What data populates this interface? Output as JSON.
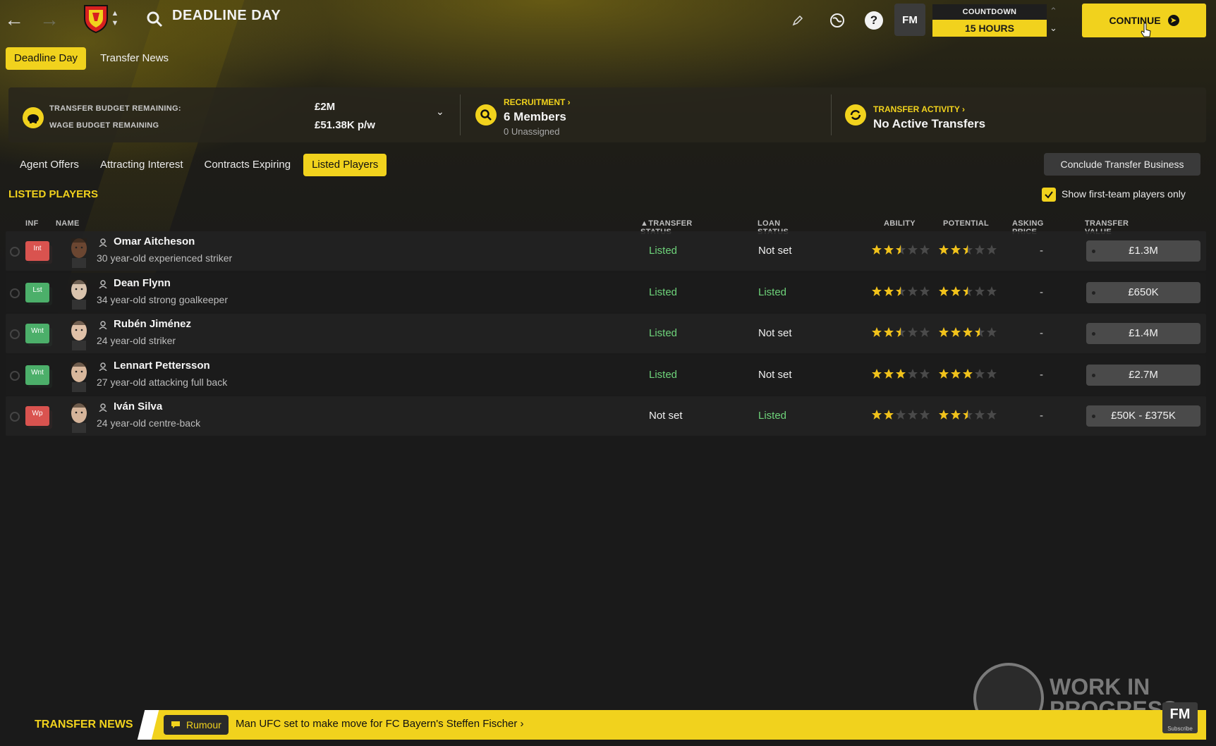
{
  "header": {
    "title": "DEADLINE DAY",
    "countdown_label": "COUNTDOWN",
    "countdown_value": "15 HOURS",
    "continue_label": "CONTINUE",
    "fm_label": "FM",
    "help_label": "?"
  },
  "top_tabs": [
    {
      "label": "Deadline Day",
      "active": true
    },
    {
      "label": "Transfer News",
      "active": false
    }
  ],
  "budget": {
    "transfer_label": "TRANSFER BUDGET REMAINING:",
    "wage_label": "WAGE BUDGET REMAINING",
    "transfer_value": "£2M",
    "wage_value": "£51.38K p/w"
  },
  "recruitment": {
    "label": "RECRUITMENT",
    "value": "6 Members",
    "sub": "0 Unassigned"
  },
  "transfer_activity": {
    "label": "TRANSFER ACTIVITY",
    "value": "No Active Transfers"
  },
  "sub_tabs": [
    {
      "label": "Agent Offers",
      "active": false
    },
    {
      "label": "Attracting Interest",
      "active": false
    },
    {
      "label": "Contracts Expiring",
      "active": false
    },
    {
      "label": "Listed Players",
      "active": true
    }
  ],
  "conclude_label": "Conclude Transfer Business",
  "section_title": "LISTED PLAYERS",
  "first_team_label": "Show first-team players only",
  "first_team_checked": true,
  "columns": {
    "inf": "INF",
    "name": "NAME",
    "transfer_status": "TRANSFER STATUS",
    "loan_status": "LOAN STATUS",
    "ability": "ABILITY",
    "potential": "POTENTIAL",
    "asking_price": "ASKING PRICE",
    "transfer_value": "TRANSFER VALUE"
  },
  "players": [
    {
      "inf": "Int",
      "inf_color": "#d9534f",
      "name": "Omar Aitcheson",
      "desc": "30 year-old experienced striker",
      "transfer_status": "Listed",
      "loan_status": "Not set",
      "ability": 2.5,
      "potential": 2.5,
      "asking_price": "-",
      "transfer_value": "£1.3M",
      "skin": "#6b4631"
    },
    {
      "inf": "Lst",
      "inf_color": "#4caf6a",
      "name": "Dean Flynn",
      "desc": "34 year-old strong goalkeeper",
      "transfer_status": "Listed",
      "loan_status": "Listed",
      "ability": 2.5,
      "potential": 2.5,
      "asking_price": "-",
      "transfer_value": "£650K",
      "skin": "#d9c3ad"
    },
    {
      "inf": "Wnt",
      "inf_color": "#4caf6a",
      "name": "Rubén Jiménez",
      "desc": "24 year-old striker",
      "transfer_status": "Listed",
      "loan_status": "Not set",
      "ability": 2.5,
      "potential": 3.5,
      "asking_price": "-",
      "transfer_value": "£1.4M",
      "skin": "#e0c1a8"
    },
    {
      "inf": "Wnt",
      "inf_color": "#4caf6a",
      "name": "Lennart Pettersson",
      "desc": "27 year-old attacking full back",
      "transfer_status": "Listed",
      "loan_status": "Not set",
      "ability": 3,
      "potential": 3,
      "asking_price": "-",
      "transfer_value": "£2.7M",
      "skin": "#d8b79c"
    },
    {
      "inf": "Wp",
      "inf_color": "#d9534f",
      "name": "Iván Silva",
      "desc": "24 year-old centre-back",
      "transfer_status": "Not set",
      "loan_status": "Listed",
      "ability": 2,
      "potential": 2.5,
      "asking_price": "-",
      "transfer_value": "£50K - £375K",
      "skin": "#d5b49a"
    }
  ],
  "news": {
    "label": "TRANSFER NEWS",
    "tag": "Rumour",
    "text": "Man UFC set to make move for FC Bayern's Steffen Fischer"
  },
  "watermark": {
    "line1": "WORK IN",
    "line2": "PROGRESS",
    "fm": "FM",
    "fm_sub": "Subscribe"
  },
  "colors": {
    "accent": "#f1d21d",
    "listed_green": "#6ed37a",
    "star": "#f1c21b",
    "star_empty": "#4a4a4a"
  }
}
